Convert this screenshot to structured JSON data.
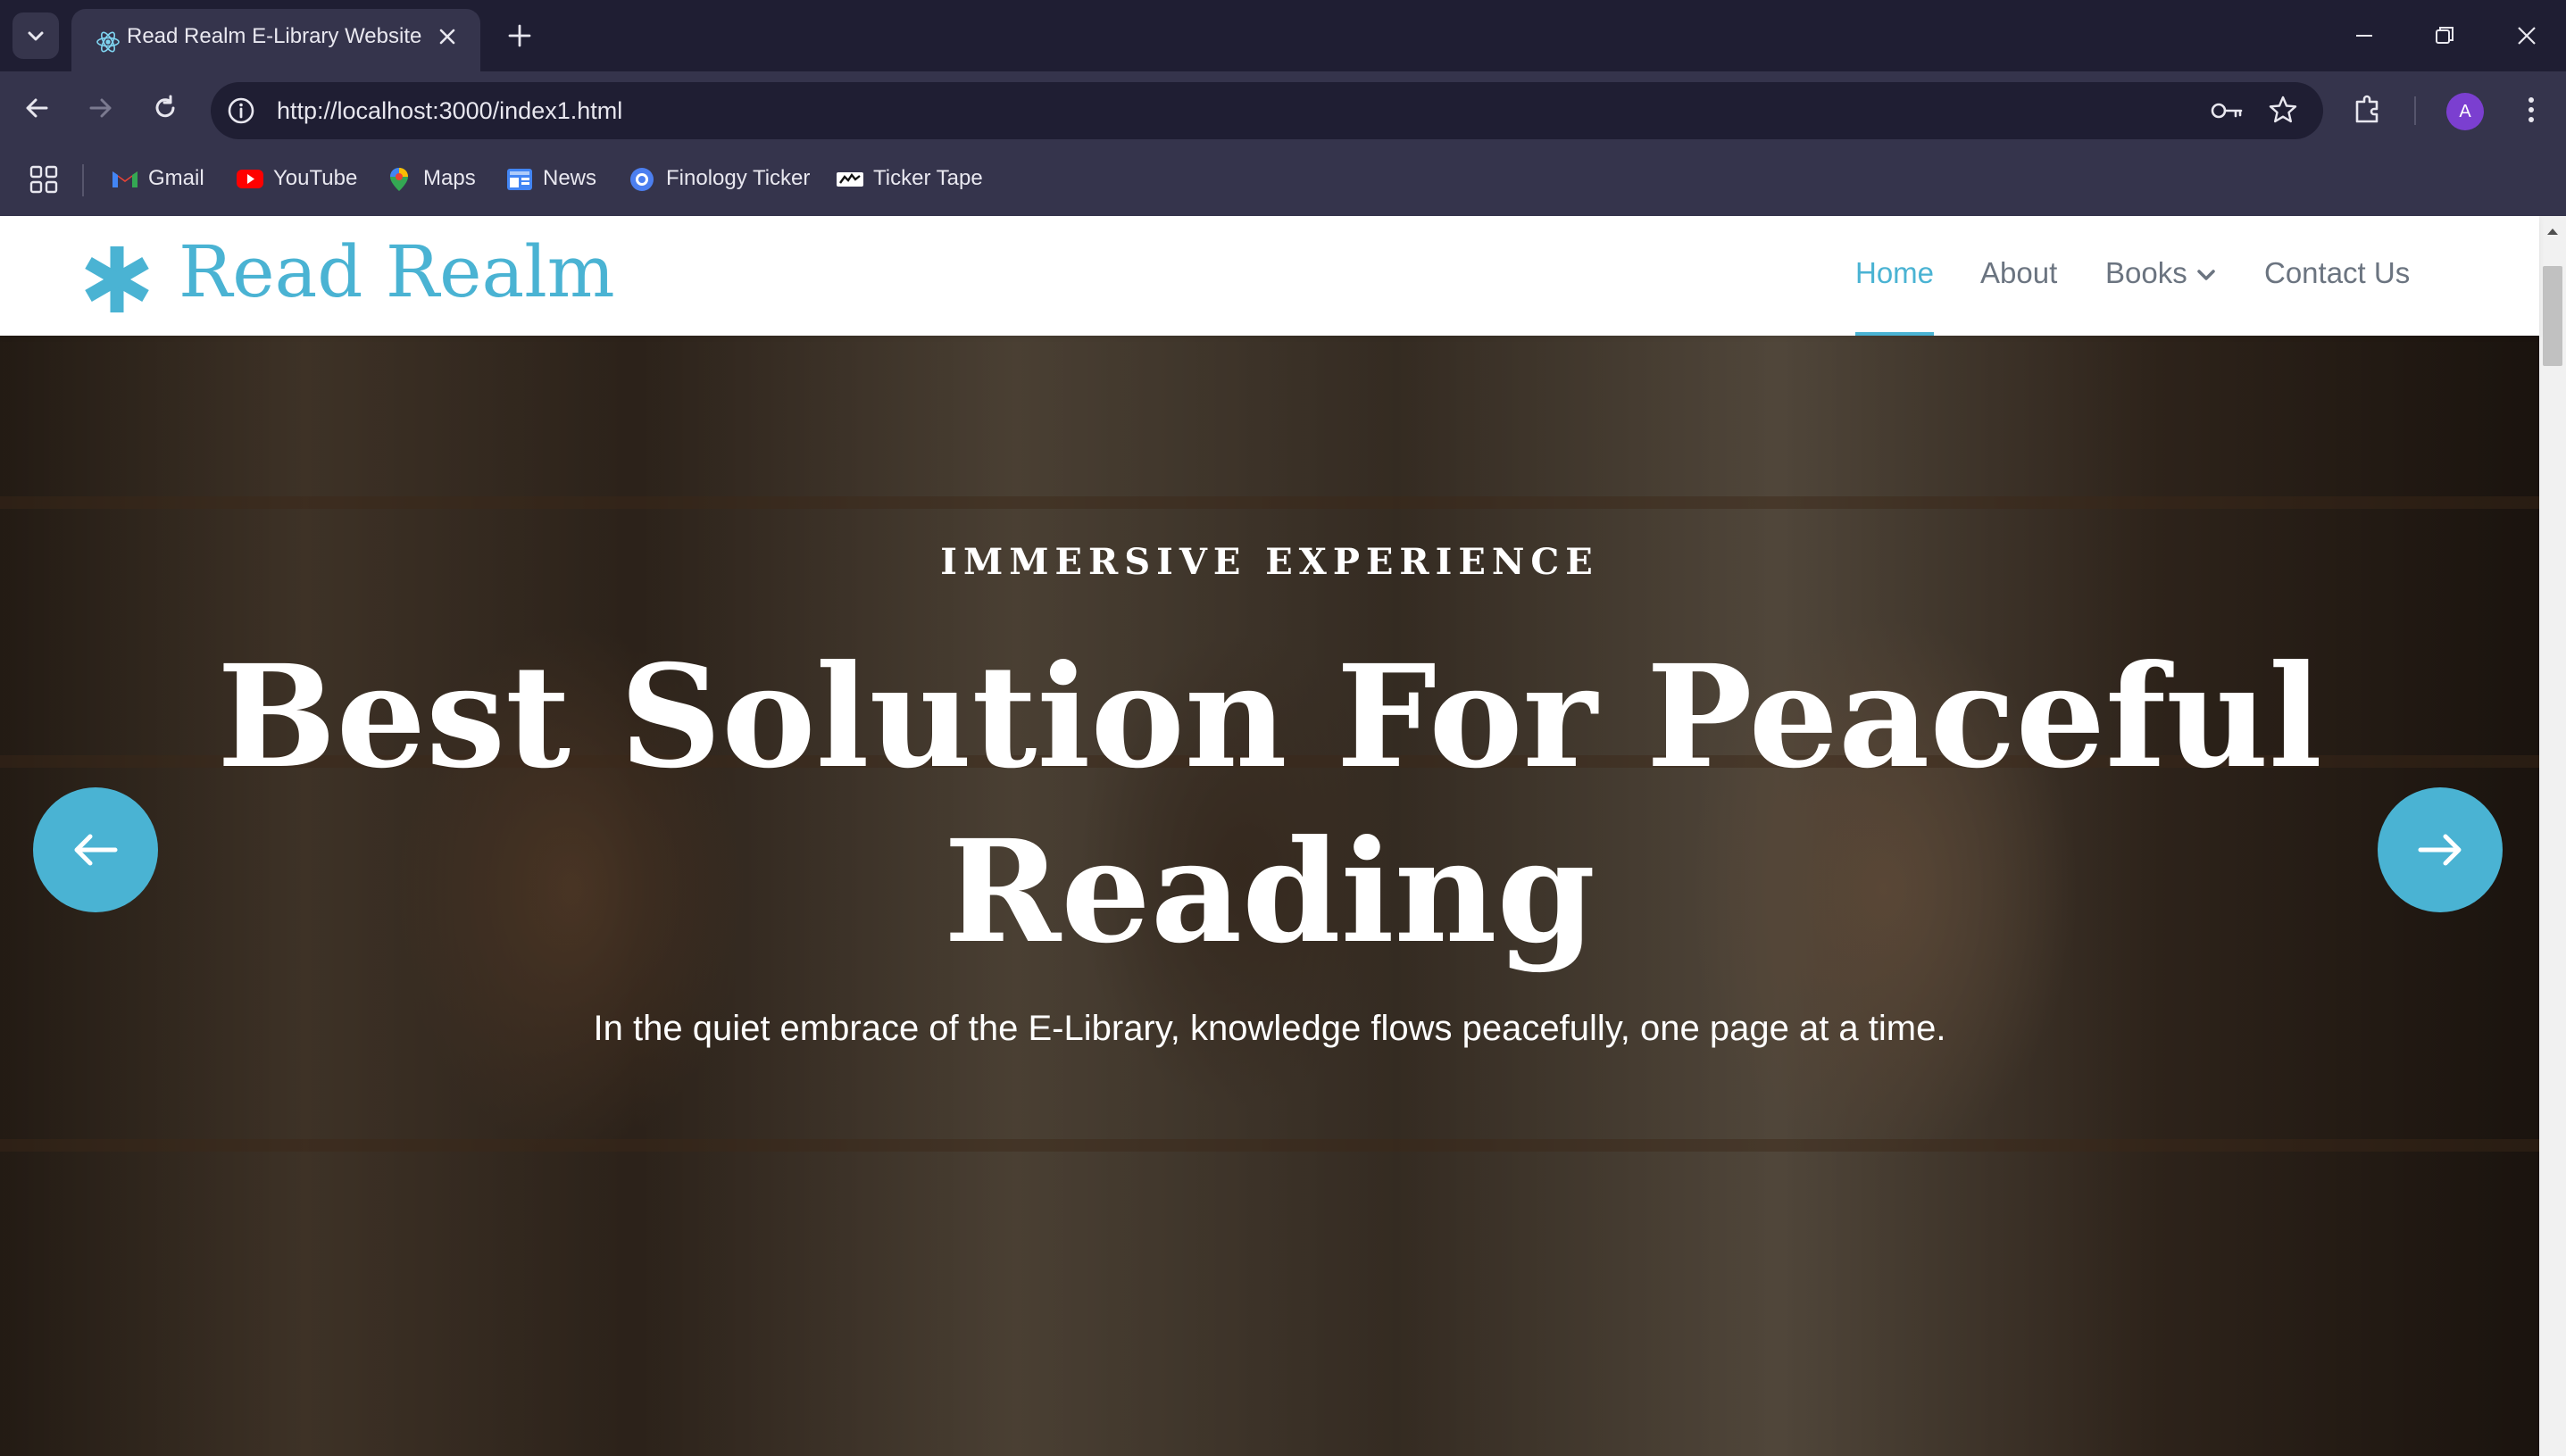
{
  "browser": {
    "tab": {
      "title": "Read Realm E-Library Website"
    },
    "address_bar": {
      "url": "http://localhost:3000/index1.html"
    },
    "profile_initial": "A",
    "bookmarks": [
      {
        "label": "Gmail",
        "icon": "gmail-icon"
      },
      {
        "label": "YouTube",
        "icon": "youtube-icon"
      },
      {
        "label": "Maps",
        "icon": "maps-icon"
      },
      {
        "label": "News",
        "icon": "news-icon"
      },
      {
        "label": "Finology Ticker",
        "icon": "finology-icon"
      },
      {
        "label": "Ticker Tape",
        "icon": "tickertape-icon"
      }
    ]
  },
  "site": {
    "brand": "Read Realm",
    "brand_color": "#4ab3d3",
    "nav": {
      "home": "Home",
      "about": "About",
      "books": "Books",
      "contact": "Contact Us"
    },
    "hero": {
      "kicker": "IMMERSIVE EXPERIENCE",
      "title": "Best Solution For Peaceful Reading",
      "subtitle": "In the quiet embrace of the E-Library, knowledge flows peacefully, one page at a time."
    }
  }
}
